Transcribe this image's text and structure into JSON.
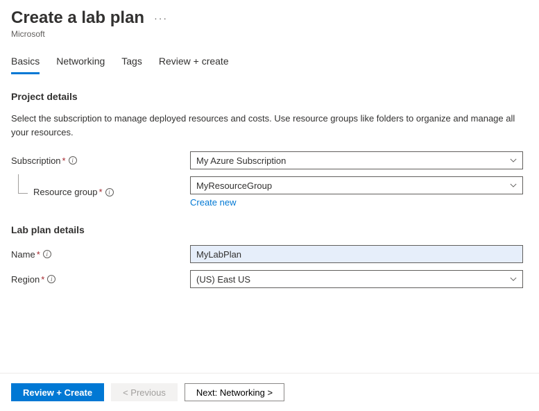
{
  "header": {
    "title": "Create a lab plan",
    "subtitle": "Microsoft",
    "more": "···"
  },
  "tabs": [
    {
      "label": "Basics",
      "active": true
    },
    {
      "label": "Networking",
      "active": false
    },
    {
      "label": "Tags",
      "active": false
    },
    {
      "label": "Review + create",
      "active": false
    }
  ],
  "project_details": {
    "heading": "Project details",
    "description": "Select the subscription to manage deployed resources and costs. Use resource groups like folders to organize and manage all your resources.",
    "subscription_label": "Subscription",
    "subscription_value": "My Azure Subscription",
    "resource_group_label": "Resource group",
    "resource_group_value": "MyResourceGroup",
    "create_new": "Create new"
  },
  "lab_plan_details": {
    "heading": "Lab plan details",
    "name_label": "Name",
    "name_value": "MyLabPlan",
    "region_label": "Region",
    "region_value": "(US) East US"
  },
  "footer": {
    "review_create": "Review + Create",
    "previous": "< Previous",
    "next": "Next: Networking >"
  }
}
